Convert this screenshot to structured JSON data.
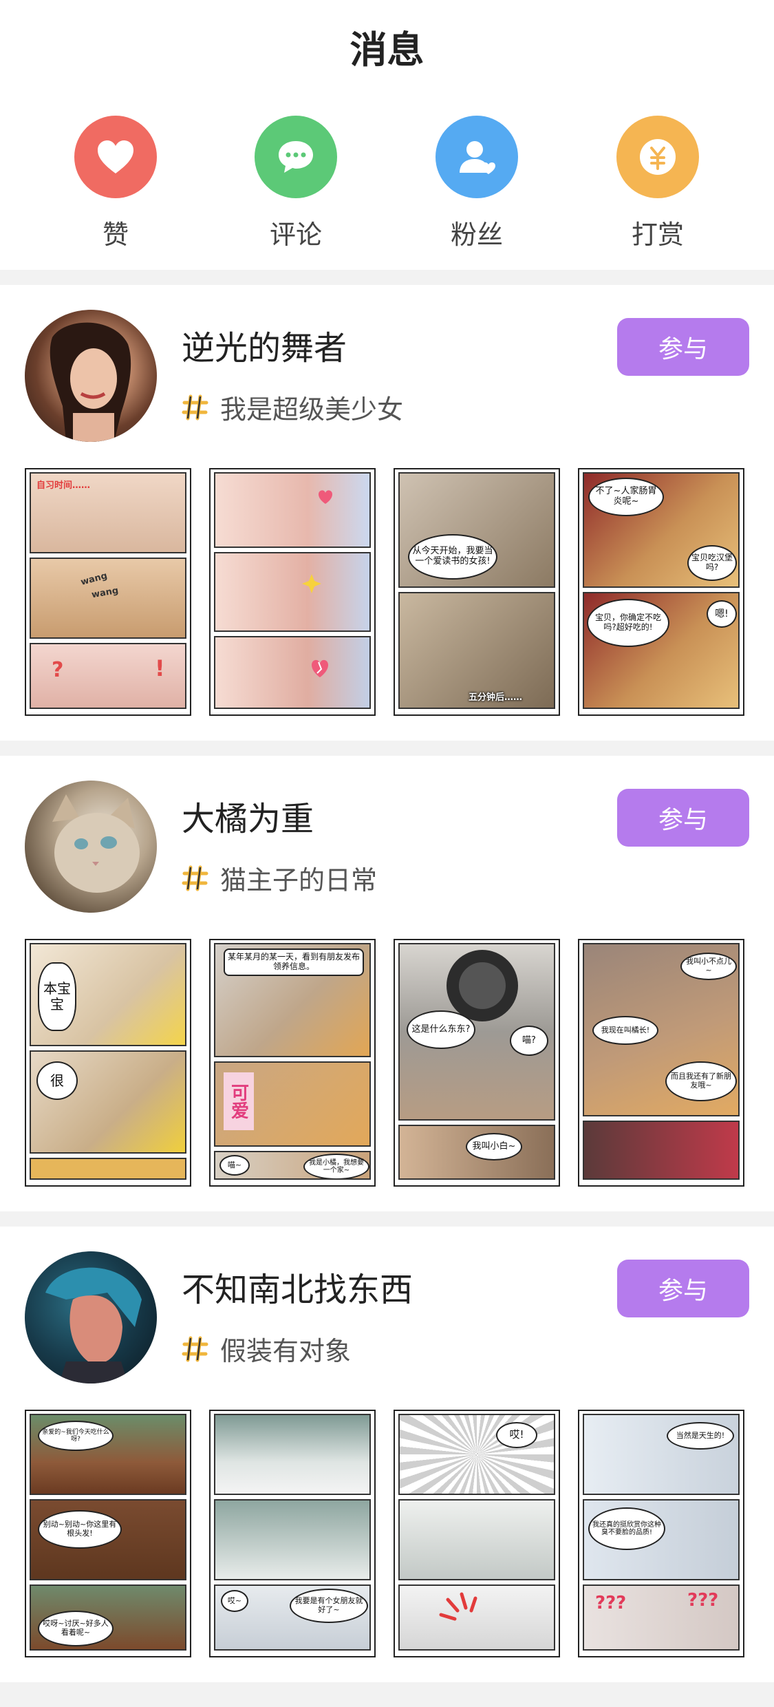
{
  "header": {
    "title": "消息"
  },
  "categories": [
    {
      "label": "赞",
      "icon": "heart-icon",
      "color": "#f06b62"
    },
    {
      "label": "评论",
      "icon": "comment-icon",
      "color": "#5cc977"
    },
    {
      "label": "粉丝",
      "icon": "fans-icon",
      "color": "#55aaf2"
    },
    {
      "label": "打赏",
      "icon": "reward-icon",
      "color": "#f5b552"
    }
  ],
  "accent": "#b57bed",
  "posts": [
    {
      "name": "逆光的舞者",
      "tag": "我是超级美少女",
      "join_label": "参与",
      "thumbs": [
        {
          "texts": [
            "自习时间……",
            "wang",
            "wang"
          ]
        },
        {
          "texts": []
        },
        {
          "texts": [
            "从今天开始，我要当一个爱读书的女孩!",
            "五分钟后……"
          ]
        },
        {
          "texts": [
            "不了~人家肠胃炎呢~",
            "宝贝吃汉堡吗?",
            "宝贝，你确定不吃吗?超好吃的!",
            "嗯!"
          ]
        }
      ]
    },
    {
      "name": "大橘为重",
      "tag": "猫主子的日常",
      "join_label": "参与",
      "thumbs": [
        {
          "texts": [
            "本宝宝",
            "很"
          ]
        },
        {
          "texts": [
            "某年某月的某一天，看到有朋友发布领养信息。",
            "可爱",
            "喵~",
            "我是小橘，我想要一个家~"
          ]
        },
        {
          "texts": [
            "这是什么东东?",
            "喵?",
            "我叫小白~"
          ]
        },
        {
          "texts": [
            "我叫小不点儿~",
            "我现在叫橘长!",
            "而且我还有了新朋友哦~"
          ]
        }
      ]
    },
    {
      "name": "不知南北找东西",
      "tag": "假装有对象",
      "join_label": "参与",
      "thumbs": [
        {
          "texts": [
            "亲爱的~我们今天吃什么呀?",
            "别动~别动~你这里有根头发!",
            "哎呀~讨厌~好多人看着呢~"
          ]
        },
        {
          "texts": [
            "哎~",
            "我要是有个女朋友就好了~"
          ]
        },
        {
          "texts": [
            "哎!"
          ]
        },
        {
          "texts": [
            "当然是天生的!",
            "我还真的挺欣赏你这种臭不要脸的品质!"
          ]
        }
      ]
    }
  ]
}
